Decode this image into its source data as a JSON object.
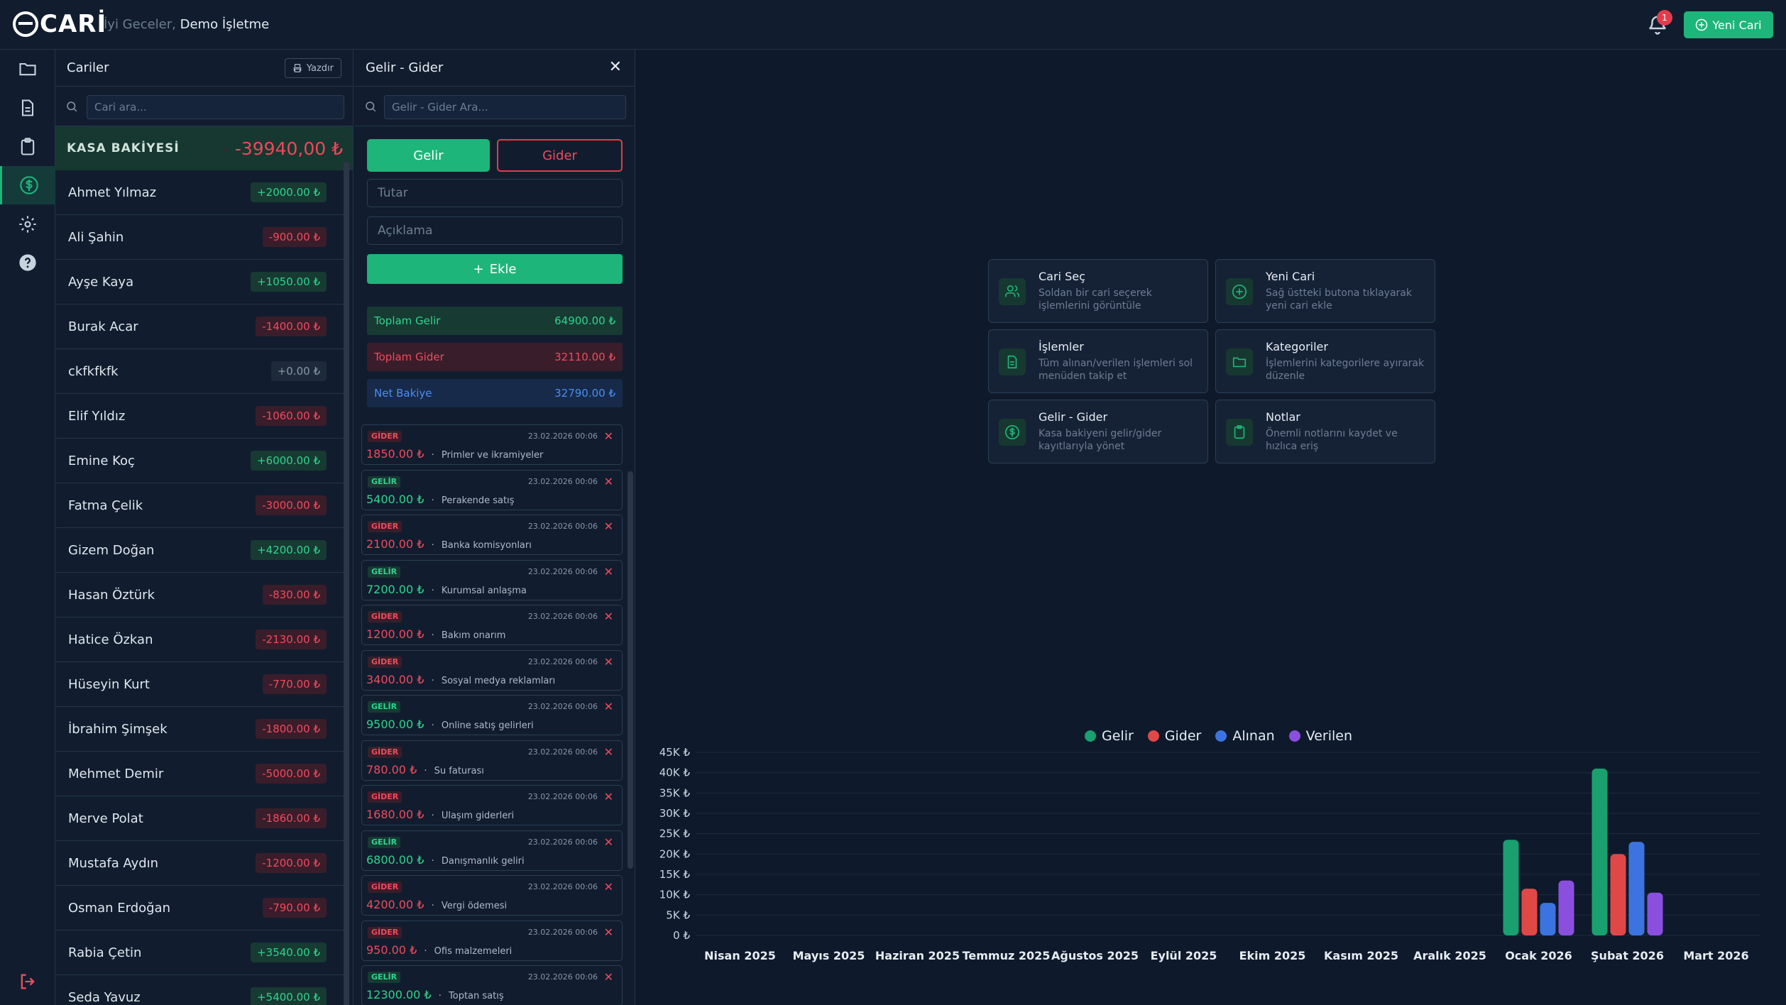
{
  "topbar": {
    "logo_text": "CARİ",
    "greeting": "İyi Geceler,",
    "business": "Demo İşletme",
    "notif_count": "1",
    "new_cari_label": "Yeni Cari"
  },
  "cariler": {
    "title": "Cariler",
    "print_label": "Yazdır",
    "search_placeholder": "Cari ara...",
    "kasa_label": "KASA BAKİYESİ",
    "kasa_value": "-39940,00 ₺",
    "items": [
      {
        "name": "Ahmet Yılmaz",
        "balance": "+2000.00 ₺",
        "kind": "pos"
      },
      {
        "name": "Ali Şahin",
        "balance": "-900.00 ₺",
        "kind": "neg"
      },
      {
        "name": "Ayşe Kaya",
        "balance": "+1050.00 ₺",
        "kind": "pos"
      },
      {
        "name": "Burak Acar",
        "balance": "-1400.00 ₺",
        "kind": "neg"
      },
      {
        "name": "ckfkfkfk",
        "balance": "+0.00 ₺",
        "kind": "zero"
      },
      {
        "name": "Elif Yıldız",
        "balance": "-1060.00 ₺",
        "kind": "neg"
      },
      {
        "name": "Emine Koç",
        "balance": "+6000.00 ₺",
        "kind": "pos"
      },
      {
        "name": "Fatma Çelik",
        "balance": "-3000.00 ₺",
        "kind": "neg"
      },
      {
        "name": "Gizem Doğan",
        "balance": "+4200.00 ₺",
        "kind": "pos"
      },
      {
        "name": "Hasan Öztürk",
        "balance": "-830.00 ₺",
        "kind": "neg"
      },
      {
        "name": "Hatice Özkan",
        "balance": "-2130.00 ₺",
        "kind": "neg"
      },
      {
        "name": "Hüseyin Kurt",
        "balance": "-770.00 ₺",
        "kind": "neg"
      },
      {
        "name": "İbrahim Şimşek",
        "balance": "-1800.00 ₺",
        "kind": "neg"
      },
      {
        "name": "Mehmet Demir",
        "balance": "-5000.00 ₺",
        "kind": "neg"
      },
      {
        "name": "Merve Polat",
        "balance": "-1860.00 ₺",
        "kind": "neg"
      },
      {
        "name": "Mustafa Aydın",
        "balance": "-1200.00 ₺",
        "kind": "neg"
      },
      {
        "name": "Osman Erdoğan",
        "balance": "-790.00 ₺",
        "kind": "neg"
      },
      {
        "name": "Rabia Çetin",
        "balance": "+3540.00 ₺",
        "kind": "pos"
      },
      {
        "name": "Seda Yavuz",
        "balance": "+5400.00 ₺",
        "kind": "pos"
      }
    ]
  },
  "gelir_gider": {
    "title": "Gelir - Gider",
    "search_placeholder": "Gelir - Gider Ara...",
    "tab_gelir": "Gelir",
    "tab_gider": "Gider",
    "amount_placeholder": "Tutar",
    "desc_placeholder": "Açıklama",
    "add_label": "Ekle",
    "total_income_label": "Toplam Gelir",
    "total_income": "64900.00 ₺",
    "total_expense_label": "Toplam Gider",
    "total_expense": "32110.00 ₺",
    "net_label": "Net Bakiye",
    "net": "32790.00 ₺",
    "transactions": [
      {
        "type": "GİDER",
        "kind": "gider",
        "date": "23.02.2026 00:06",
        "amount": "1850.00 ₺",
        "desc": "Primler ve ikramiyeler"
      },
      {
        "type": "GELİR",
        "kind": "gelir",
        "date": "23.02.2026 00:06",
        "amount": "5400.00 ₺",
        "desc": "Perakende satış"
      },
      {
        "type": "GİDER",
        "kind": "gider",
        "date": "23.02.2026 00:06",
        "amount": "2100.00 ₺",
        "desc": "Banka komisyonları"
      },
      {
        "type": "GELİR",
        "kind": "gelir",
        "date": "23.02.2026 00:06",
        "amount": "7200.00 ₺",
        "desc": "Kurumsal anlaşma"
      },
      {
        "type": "GİDER",
        "kind": "gider",
        "date": "23.02.2026 00:06",
        "amount": "1200.00 ₺",
        "desc": "Bakım onarım"
      },
      {
        "type": "GİDER",
        "kind": "gider",
        "date": "23.02.2026 00:06",
        "amount": "3400.00 ₺",
        "desc": "Sosyal medya reklamları"
      },
      {
        "type": "GELİR",
        "kind": "gelir",
        "date": "23.02.2026 00:06",
        "amount": "9500.00 ₺",
        "desc": "Online satış gelirleri"
      },
      {
        "type": "GİDER",
        "kind": "gider",
        "date": "23.02.2026 00:06",
        "amount": "780.00 ₺",
        "desc": "Su faturası"
      },
      {
        "type": "GİDER",
        "kind": "gider",
        "date": "23.02.2026 00:06",
        "amount": "1680.00 ₺",
        "desc": "Ulaşım giderleri"
      },
      {
        "type": "GELİR",
        "kind": "gelir",
        "date": "23.02.2026 00:06",
        "amount": "6800.00 ₺",
        "desc": "Danışmanlık geliri"
      },
      {
        "type": "GİDER",
        "kind": "gider",
        "date": "23.02.2026 00:06",
        "amount": "4200.00 ₺",
        "desc": "Vergi ödemesi"
      },
      {
        "type": "GİDER",
        "kind": "gider",
        "date": "23.02.2026 00:06",
        "amount": "950.00 ₺",
        "desc": "Ofis malzemeleri"
      },
      {
        "type": "GELİR",
        "kind": "gelir",
        "date": "23.02.2026 00:06",
        "amount": "12300.00 ₺",
        "desc": "Toptan satış"
      }
    ]
  },
  "cards": [
    {
      "icon": "users-icon",
      "title": "Cari Seç",
      "desc": "Soldan bir cari seçerek işlemlerini görüntüle"
    },
    {
      "icon": "plus-circle-icon",
      "title": "Yeni Cari",
      "desc": "Sağ üstteki butona tıklayarak yeni cari ekle"
    },
    {
      "icon": "document-icon",
      "title": "İşlemler",
      "desc": "Tüm alınan/verilen işlemleri sol menüden takip et"
    },
    {
      "icon": "folder-icon",
      "title": "Kategoriler",
      "desc": "İşlemlerini kategorilere ayırarak düzenle"
    },
    {
      "icon": "dollar-icon",
      "title": "Gelir - Gider",
      "desc": "Kasa bakiyeni gelir/gider kayıtlarıyla yönet"
    },
    {
      "icon": "clipboard-icon",
      "title": "Notlar",
      "desc": "Önemli notlarını kaydet ve hızlıca eriş"
    }
  ],
  "colors": {
    "gelir": "#1aa06f",
    "gider": "#e04848",
    "alinan": "#3b74e0",
    "verilen": "#8b4fe0",
    "accent": "#1db57a"
  },
  "chart_data": {
    "type": "bar",
    "categories": [
      "Nisan 2025",
      "Mayıs 2025",
      "Haziran 2025",
      "Temmuz 2025",
      "Ağustos 2025",
      "Eylül 2025",
      "Ekim 2025",
      "Kasım 2025",
      "Aralık 2025",
      "Ocak 2026",
      "Şubat 2026",
      "Mart 2026"
    ],
    "series": [
      {
        "name": "Gelir",
        "values": [
          0,
          0,
          0,
          0,
          0,
          0,
          0,
          0,
          0,
          23500,
          41000,
          0
        ]
      },
      {
        "name": "Gider",
        "values": [
          0,
          0,
          0,
          0,
          0,
          0,
          0,
          0,
          0,
          11500,
          20000,
          0
        ]
      },
      {
        "name": "Alınan",
        "values": [
          0,
          0,
          0,
          0,
          0,
          0,
          0,
          0,
          0,
          8000,
          23000,
          0
        ]
      },
      {
        "name": "Verilen",
        "values": [
          0,
          0,
          0,
          0,
          0,
          0,
          0,
          0,
          0,
          13500,
          10500,
          0
        ]
      }
    ],
    "yticks": [
      "0 ₺",
      "5K ₺",
      "10K ₺",
      "15K ₺",
      "20K ₺",
      "25K ₺",
      "30K ₺",
      "35K ₺",
      "40K ₺",
      "45K ₺"
    ],
    "ylim": [
      0,
      45000
    ],
    "legend_position": "top-center",
    "grid": true
  }
}
